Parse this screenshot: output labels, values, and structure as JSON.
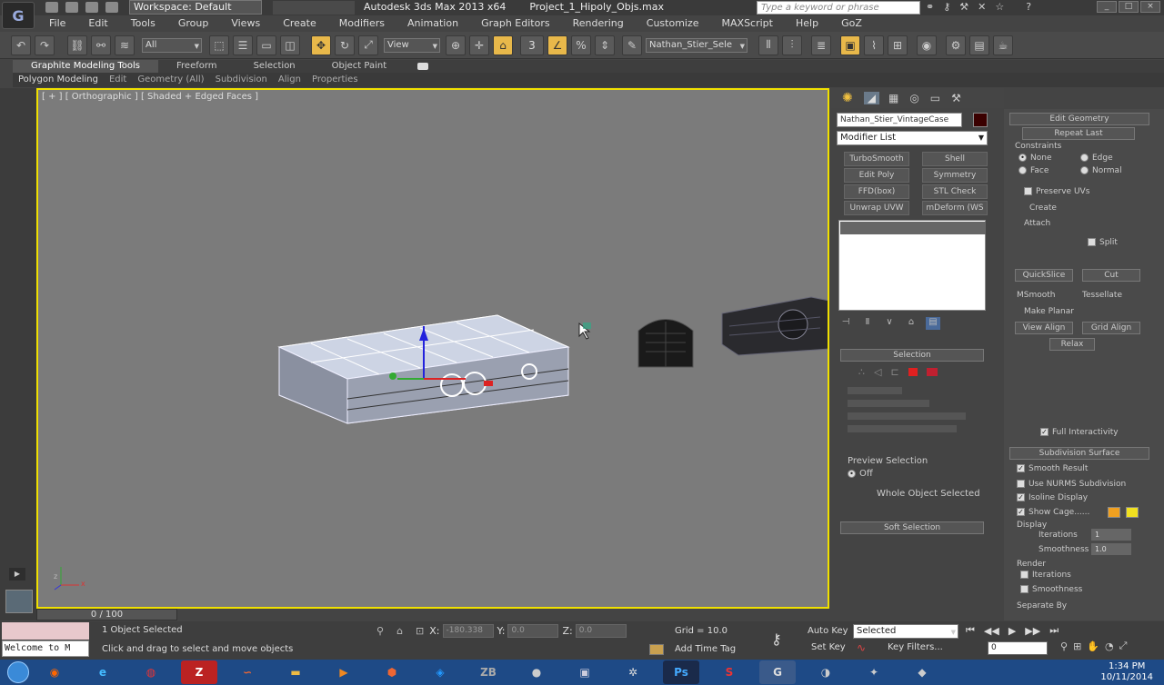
{
  "titlebar": {
    "workspace_label": "Workspace: Default",
    "app_name": "Autodesk 3ds Max  2013 x64",
    "file_name": "Project_1_Hipoly_Objs.max",
    "search_placeholder": "Type a keyword or phrase"
  },
  "menu": [
    "File",
    "Edit",
    "Tools",
    "Group",
    "Views",
    "Create",
    "Modifiers",
    "Animation",
    "Graph Editors",
    "Rendering",
    "Customize",
    "MAXScript",
    "Help",
    "GoZ"
  ],
  "toolbar": {
    "filter_select": "All",
    "coord_select": "View",
    "snap_label": "3",
    "named_selection": "Nathan_Stier_Sele"
  },
  "ribbon": {
    "tabs": [
      "Graphite Modeling Tools",
      "Freeform",
      "Selection",
      "Object Paint"
    ],
    "sub": [
      "Polygon Modeling",
      "Edit",
      "Geometry (All)",
      "Subdivision",
      "Align",
      "Properties"
    ]
  },
  "viewport": {
    "label": "[ + ] [ Orthographic ] [ Shaded + Edged Faces ]"
  },
  "command_panel": {
    "object_name": "Nathan_Stier_VintageCase",
    "modifier_list_label": "Modifier List",
    "modifier_buttons": [
      "TurboSmooth",
      "Shell",
      "Edit Poly",
      "Symmetry",
      "FFD(box)",
      "STL Check",
      "Unwrap UVW",
      "mDeform (WS"
    ],
    "selection_rollout": "Selection",
    "preview_selection": "Preview Selection",
    "preview_off": "Off",
    "whole_object": "Whole Object Selected",
    "soft_selection": "Soft Selection"
  },
  "right_panel": {
    "edit_geometry": "Edit Geometry",
    "repeat_last": "Repeat Last",
    "constraints": "Constraints",
    "opt_none": "None",
    "opt_edge": "Edge",
    "opt_face": "Face",
    "opt_normal": "Normal",
    "preserve_uvs": "Preserve UVs",
    "create": "Create",
    "attach": "Attach",
    "split": "Split",
    "quickslice": "QuickSlice",
    "cut": "Cut",
    "msmooth": "MSmooth",
    "tessellate": "Tessellate",
    "make_planar": "Make Planar",
    "view_align": "View Align",
    "grid_align": "Grid Align",
    "relax": "Relax",
    "full_interactivity": "Full Interactivity",
    "subdivision_surface": "Subdivision Surface",
    "smooth_result": "Smooth Result",
    "use_nurms": "Use NURMS Subdivision",
    "isoline_display": "Isoline Display",
    "show_cage": "Show Cage......",
    "display": "Display",
    "iterations": "Iterations",
    "iterations_val": "1",
    "smoothness": "Smoothness",
    "smoothness_val": "1.0",
    "render": "Render",
    "separate_by": "Separate By",
    "cage_color1": "#f0a020",
    "cage_color2": "#f0e020"
  },
  "timeline": {
    "label": "0 / 100"
  },
  "status": {
    "welcome": "Welcome to M",
    "selected_count": "1 Object Selected",
    "prompt": "Click and drag to select and move objects",
    "x_label": "X:",
    "x_val": "-180.338",
    "y_label": "Y:",
    "y_val": "0.0",
    "z_label": "Z:",
    "z_val": "0.0",
    "grid": "Grid = 10.0",
    "auto_key": "Auto Key",
    "set_key": "Set Key",
    "key_mode": "Selected",
    "key_filters": "Key Filters...",
    "add_time_tag": "Add Time Tag",
    "frame": "0"
  },
  "taskbar": {
    "time": "1:34 PM",
    "date": "10/11/2014"
  }
}
